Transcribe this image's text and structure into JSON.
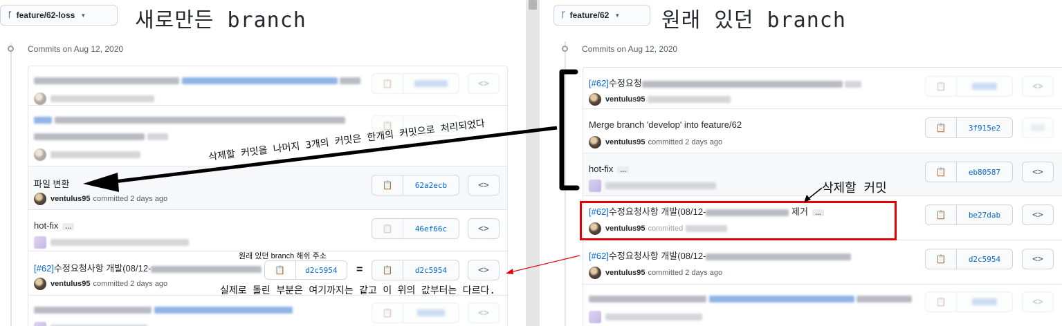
{
  "left": {
    "branch": "feature/62-loss",
    "title": "새로만든 branch",
    "commits_header": "Commits on Aug 12, 2020",
    "rows": [
      {
        "message": "",
        "sha": "",
        "blurred": true
      },
      {
        "message": "",
        "sha": "",
        "blurred": true
      },
      {
        "message": "파일 변환",
        "author": "ventulus95",
        "meta": "committed 2 days ago",
        "sha": "62a2ecb"
      },
      {
        "message": "hot-fix",
        "sha": "46ef66c"
      },
      {
        "issue": "[#62]",
        "message": "수정요청사항 개발(08/12-",
        "author": "ventulus95",
        "meta": "committed 2 days ago",
        "sha": "d2c5954"
      },
      {
        "message": "",
        "sha": "",
        "blurred": true
      }
    ]
  },
  "right": {
    "branch": "feature/62",
    "title": "원래 있던 branch",
    "commits_header": "Commits on Aug 12, 2020",
    "rows": [
      {
        "issue": "[#62]",
        "message": "수정요청",
        "author": "ventulus95",
        "sha": ""
      },
      {
        "message": "Merge branch 'develop' into feature/62",
        "author": "ventulus95",
        "meta": "committed 2 days ago",
        "sha": "3f915e2"
      },
      {
        "message": "hot-fix",
        "sha": "eb80587"
      },
      {
        "issue": "[#62]",
        "message": "수정요청사항 개발(08/12-",
        "message_end": "제거",
        "author": "ventulus95",
        "meta": "committed",
        "sha": "be27dab"
      },
      {
        "issue": "[#62]",
        "message": "수정요청사항 개발(08/12-",
        "author": "ventulus95",
        "meta": "committed 2 days ago",
        "sha": "d2c5954"
      },
      {
        "message": "",
        "sha": "",
        "blurred": true
      }
    ]
  },
  "annotations": {
    "arrow_text": "삭제할 커밋을 나머지 3개의 커밋은 한개의 커밋으로 처리되었다",
    "delete_label": "삭제할 커밋",
    "original_hash_label": "원래 있던 branch 해쉬 주소",
    "original_hash": "d2c5954",
    "equals": "=",
    "note": "실제로 돌린 부분은 여기까지는 같고 이 위의 값부터는 다르다."
  },
  "icons": {
    "branch": "git-branch-icon",
    "copy": "clipboard-icon",
    "browse": "code-icon",
    "caret": "caret-down-icon"
  }
}
